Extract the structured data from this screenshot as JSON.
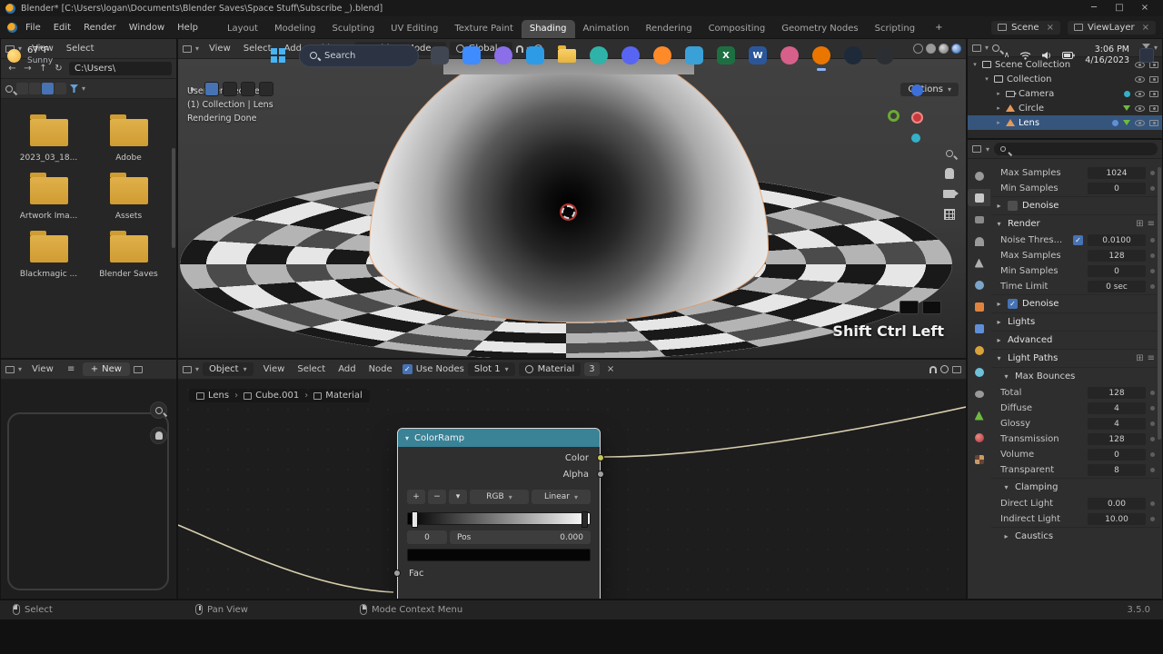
{
  "titlebar": {
    "title": "Blender* [C:\\Users\\logan\\Documents\\Blender Saves\\Space Stuff\\Subscribe _).blend]",
    "minimize": "─",
    "maximize": "□",
    "close": "×"
  },
  "topbar": {
    "menus": [
      "File",
      "Edit",
      "Render",
      "Window",
      "Help"
    ],
    "workspaces": [
      "Layout",
      "Modeling",
      "Sculpting",
      "UV Editing",
      "Texture Paint",
      "Shading",
      "Animation",
      "Rendering",
      "Compositing",
      "Geometry Nodes",
      "Scripting"
    ],
    "active_workspace": "Shading",
    "add_workspace": "+",
    "scene": "Scene",
    "view_layer": "ViewLayer"
  },
  "file_browser": {
    "menus": [
      "View",
      "Select"
    ],
    "path": "C:\\Users\\",
    "folders": [
      "2023_03_18...",
      "Adobe",
      "Artwork Ima...",
      "Assets",
      "Blackmagic ...",
      "Blender Saves"
    ]
  },
  "viewport": {
    "menus": [
      "View",
      "Select",
      "Add",
      "Object"
    ],
    "mode": "Object Mode",
    "orientation": "Global",
    "options_label": "Options",
    "overlay_lines": [
      "User Perspective",
      "(1) Collection | Lens",
      "Rendering Done"
    ],
    "keycast": "Shift Ctrl Left"
  },
  "image_editor": {
    "menus": [
      "View"
    ],
    "new_label": "New"
  },
  "shader_editor": {
    "object_selector": "Object",
    "menus": [
      "View",
      "Select",
      "Add",
      "Node"
    ],
    "use_nodes_label": "Use Nodes",
    "slot": "Slot 1",
    "material_name": "Material",
    "material_users": "3",
    "breadcrumb": [
      "Lens",
      "Cube.001",
      "Material"
    ],
    "node": {
      "title": "ColorRamp",
      "outputs": [
        "Color",
        "Alpha"
      ],
      "add_label": "+",
      "remove_label": "−",
      "color_mode": "RGB",
      "interpolation": "Linear",
      "index": "0",
      "pos_label": "Pos",
      "pos_value": "0.000",
      "input": "Fac",
      "wire_color": "#d8cfae",
      "header_color": "#3a8296"
    }
  },
  "outliner": {
    "items": [
      {
        "label": "Scene Collection",
        "indent": 0,
        "icon": "collection",
        "chev": "open",
        "selected": false,
        "badges": []
      },
      {
        "label": "Collection",
        "indent": 1,
        "icon": "collection",
        "chev": "open",
        "selected": false,
        "badges": []
      },
      {
        "label": "Camera",
        "indent": 2,
        "icon": "camera",
        "chev": "closed",
        "selected": false,
        "badges": [
          "camera-data"
        ]
      },
      {
        "label": "Circle",
        "indent": 2,
        "icon": "mesh",
        "chev": "closed",
        "selected": false,
        "badges": [
          "mesh-data"
        ]
      },
      {
        "label": "Lens",
        "indent": 2,
        "icon": "mesh",
        "chev": "closed",
        "selected": true,
        "badges": [
          "modifier",
          "mesh-data"
        ]
      }
    ]
  },
  "properties": {
    "tabs": [
      "tool",
      "render",
      "output",
      "view-layer",
      "scene",
      "world",
      "object",
      "modifiers",
      "particles",
      "physics",
      "constraints",
      "object-data",
      "material",
      "texture"
    ],
    "active_tab": "render",
    "rows": [
      {
        "type": "value",
        "label": "Max Samples",
        "value": "1024"
      },
      {
        "type": "value",
        "label": "Min Samples",
        "value": "0"
      },
      {
        "type": "header",
        "label": "Denoise",
        "collapsed": true,
        "checkbox": "unchecked"
      },
      {
        "type": "header",
        "label": "Render",
        "collapsed": false,
        "menu": true
      },
      {
        "type": "value",
        "label": "Noise Thres...",
        "value": "0.0100",
        "checkbox": "checked"
      },
      {
        "type": "value",
        "label": "Max Samples",
        "value": "128"
      },
      {
        "type": "value",
        "label": "Min Samples",
        "value": "0"
      },
      {
        "type": "value",
        "label": "Time Limit",
        "value": "0 sec"
      },
      {
        "type": "header",
        "label": "Denoise",
        "collapsed": true,
        "checkbox": "checked"
      },
      {
        "type": "header",
        "label": "Lights",
        "collapsed": true
      },
      {
        "type": "header",
        "label": "Advanced",
        "collapsed": true
      },
      {
        "type": "header",
        "label": "Light Paths",
        "collapsed": false,
        "menu": true
      },
      {
        "type": "header",
        "label": "Max Bounces",
        "collapsed": false,
        "sub": true
      },
      {
        "type": "value",
        "label": "Total",
        "value": "128"
      },
      {
        "type": "value",
        "label": "Diffuse",
        "value": "4"
      },
      {
        "type": "value",
        "label": "Glossy",
        "value": "4"
      },
      {
        "type": "value",
        "label": "Transmission",
        "value": "128"
      },
      {
        "type": "value",
        "label": "Volume",
        "value": "0"
      },
      {
        "type": "value",
        "label": "Transparent",
        "value": "8"
      },
      {
        "type": "header",
        "label": "Clamping",
        "collapsed": false,
        "sub": true
      },
      {
        "type": "value",
        "label": "Direct Light",
        "value": "0.00"
      },
      {
        "type": "value",
        "label": "Indirect Light",
        "value": "10.00"
      },
      {
        "type": "header",
        "label": "Caustics",
        "collapsed": true,
        "sub": true
      }
    ]
  },
  "status_bar": {
    "select_label": "Select",
    "pan_label": "Pan View",
    "context_label": "Mode Context Menu",
    "version": "3.5.0"
  },
  "taskbar": {
    "weather_temp": "67°F",
    "weather_desc": "Sunny",
    "search_label": "Search",
    "time": "3:06 PM",
    "date": "4/16/2023",
    "icons": [
      {
        "name": "task-view",
        "color": "#404652",
        "glyph": "",
        "shape": "square"
      },
      {
        "name": "widgets",
        "color": "#3f8cff",
        "glyph": "",
        "shape": "square"
      },
      {
        "name": "copilot",
        "color": "#8a6fe8",
        "glyph": "",
        "shape": "circle"
      },
      {
        "name": "mail",
        "color": "#2e9be6",
        "glyph": "",
        "shape": "square"
      },
      {
        "name": "file-explorer",
        "color": "#f0c13a",
        "glyph": "",
        "shape": "folder"
      },
      {
        "name": "edge",
        "color": "#2fb3a9",
        "glyph": "",
        "shape": "circle"
      },
      {
        "name": "discord",
        "color": "#5865f2",
        "glyph": "",
        "shape": "circle"
      },
      {
        "name": "firefox",
        "color": "#ff8a2a",
        "glyph": "",
        "shape": "circle"
      },
      {
        "name": "photos",
        "color": "#3aa0d8",
        "glyph": "",
        "shape": "square"
      },
      {
        "name": "excel",
        "color": "#1d6f42",
        "glyph": "X",
        "shape": "square"
      },
      {
        "name": "word",
        "color": "#2b579a",
        "glyph": "W",
        "shape": "square"
      },
      {
        "name": "paint",
        "color": "#d6608a",
        "glyph": "",
        "shape": "circle"
      },
      {
        "name": "blender",
        "color": "#ea7600",
        "glyph": "",
        "shape": "circle",
        "active": true
      },
      {
        "name": "steam",
        "color": "#1e2a3a",
        "glyph": "",
        "shape": "circle"
      },
      {
        "name": "obs",
        "color": "#2b2f33",
        "glyph": "",
        "shape": "circle"
      }
    ]
  }
}
